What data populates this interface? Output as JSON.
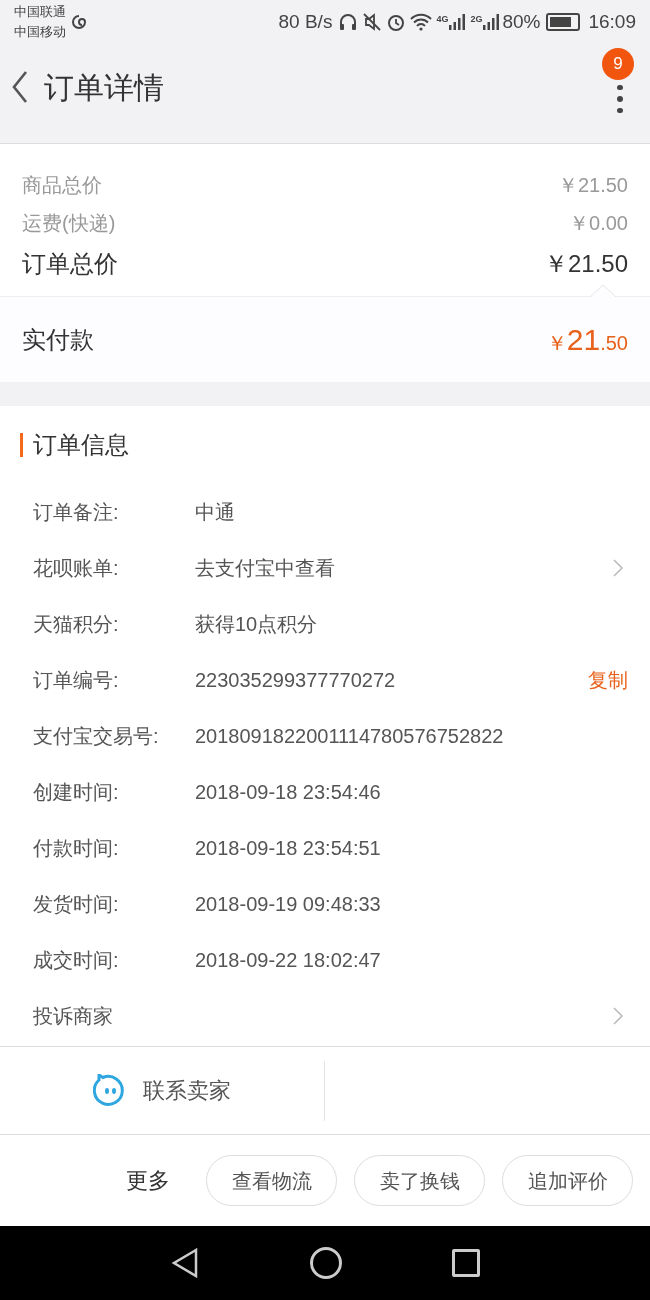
{
  "status_bar": {
    "carriers": [
      "中国联通",
      "中国移动"
    ],
    "speed": "80 B/s",
    "networks": [
      "4G",
      "2G"
    ],
    "battery": "80%",
    "time": "16:09"
  },
  "header": {
    "title": "订单详情",
    "badge": "9"
  },
  "price": {
    "rows": [
      {
        "label": "商品总价",
        "value": "￥21.50",
        "kind": "minor"
      },
      {
        "label": "运费(快递)",
        "value": "￥0.00",
        "kind": "minor"
      },
      {
        "label": "订单总价",
        "value": "￥21.50",
        "kind": "total"
      }
    ],
    "paid": {
      "label": "实付款",
      "currency": "￥",
      "integer": "21",
      "decimal": ".50"
    }
  },
  "info": {
    "title": "订单信息",
    "rows": [
      {
        "label": "订单备注:",
        "value": "中通",
        "kind": "text"
      },
      {
        "label": "花呗账单:",
        "value": "去支付宝中查看",
        "kind": "link"
      },
      {
        "label": "天猫积分:",
        "value": "获得10点积分",
        "kind": "text"
      },
      {
        "label": "订单编号:",
        "value": "223035299377770272",
        "kind": "copy",
        "action": "复制"
      },
      {
        "label": "支付宝交易号:",
        "value": "2018091822001114780576752822",
        "kind": "text"
      },
      {
        "label": "创建时间:",
        "value": "2018-09-18 23:54:46",
        "kind": "text"
      },
      {
        "label": "付款时间:",
        "value": "2018-09-18 23:54:51",
        "kind": "text"
      },
      {
        "label": "发货时间:",
        "value": "2018-09-19 09:48:33",
        "kind": "text"
      },
      {
        "label": "成交时间:",
        "value": "2018-09-22 18:02:47",
        "kind": "text"
      },
      {
        "label": "投诉商家",
        "kind": "link"
      }
    ]
  },
  "contact": {
    "label": "联系卖家"
  },
  "footer": {
    "more": "更多",
    "buttons": [
      "查看物流",
      "卖了换钱",
      "追加评价"
    ]
  }
}
